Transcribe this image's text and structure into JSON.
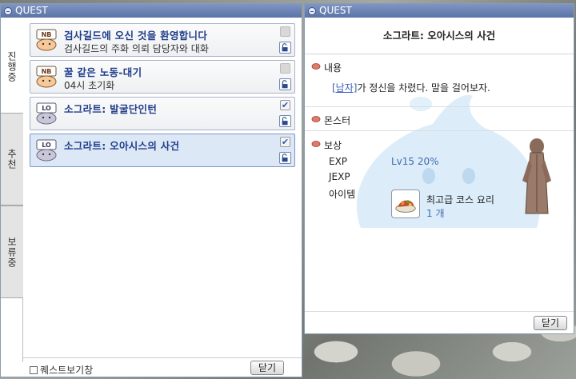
{
  "left_window": {
    "title": "QUEST",
    "tabs": [
      {
        "label": "진행중",
        "active": true
      },
      {
        "label": "추천",
        "active": false
      },
      {
        "label": "보류중",
        "active": false
      }
    ],
    "quests": [
      {
        "icon": "NB",
        "title": "검사길드에 오신 것을 환영합니다",
        "subtitle": "검사길드의 주화 의뢰 담당자와 대화",
        "checked": false,
        "disabled": true
      },
      {
        "icon": "NB",
        "title": "꿀 같은 노동-대기",
        "subtitle": "04시 초기화",
        "checked": false,
        "disabled": true
      },
      {
        "icon": "LO",
        "title": "소그라트: 발굴단인턴",
        "subtitle": "",
        "checked": true,
        "disabled": false
      },
      {
        "icon": "LO",
        "title": "소그라트: 오아시스의 사건",
        "subtitle": "",
        "checked": true,
        "disabled": false
      }
    ],
    "show_window_label": "퀘스트보기창",
    "close_label": "닫기"
  },
  "right_window": {
    "title": "QUEST",
    "quest_title": "소그라트: 오아시스의 사건",
    "content_label": "내용",
    "content_npc": "[남자]",
    "content_text": "가 정신을 차렸다. 말을 걸어보자.",
    "monster_label": "몬스터",
    "reward_label": "보상",
    "exp_label": "EXP",
    "exp_value": "Lv15 20%",
    "jexp_label": "JEXP",
    "item_label": "아이템",
    "item_name": "최고급 코스 요리",
    "item_count": "1 개",
    "close_label": "닫기"
  },
  "colors": {
    "titlebar": "#6a82b4",
    "quest_title": "#1f3d8a",
    "link": "#3a5fb8",
    "value_blue": "#3d6bb0"
  }
}
